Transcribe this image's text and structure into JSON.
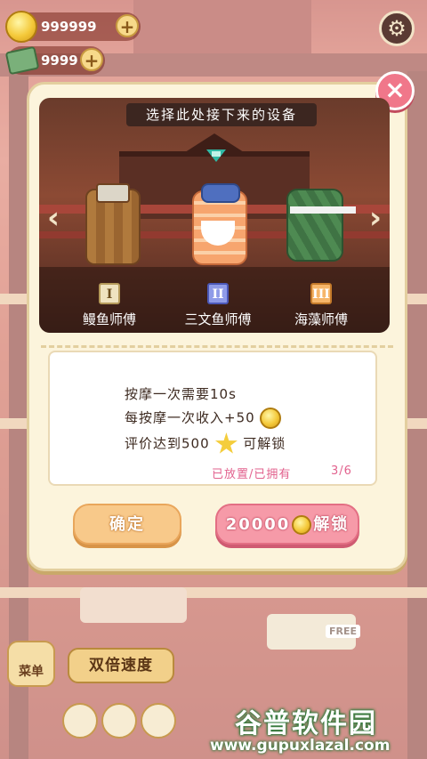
{
  "hud": {
    "coins": "999999",
    "cash": "9999",
    "coin_plus": "+",
    "cash_plus": "+"
  },
  "modal": {
    "title": "选择此处接下来的设备",
    "close_symbol": "×",
    "left_arrow": "‹",
    "right_arrow": "›",
    "masters": [
      {
        "numeral": "I",
        "name": "鳗鱼师傅"
      },
      {
        "numeral": "II",
        "name": "三文鱼师傅"
      },
      {
        "numeral": "III",
        "name": "海藻师傅"
      }
    ],
    "selected_index": 1,
    "info": {
      "line1": "按摩一次需要10s",
      "line2": "每按摩一次收入+50",
      "line3_prefix": "评价达到500",
      "line3_suffix": "可解锁",
      "status": "已放置/已拥有",
      "count": "3/6"
    },
    "confirm_label": "确定",
    "unlock_price": "20000",
    "unlock_label": "解锁"
  },
  "bottom": {
    "menu_label": "菜单",
    "speed_label": "双倍速度",
    "free_label": "FREE"
  },
  "watermark": {
    "title": "谷普软件园",
    "url": "www.gupuxlazal.com"
  },
  "colors": {
    "modal_bg": "#fcf4dc",
    "confirm": "#f8c98a",
    "unlock": "#f69aa8",
    "close": "#f0778a",
    "status_text": "#e2628e"
  },
  "icons": [
    "coin-icon",
    "cash-icon",
    "gear-icon",
    "close-icon",
    "arrow-left-icon",
    "arrow-right-icon",
    "star-icon",
    "selection-marker-icon"
  ]
}
